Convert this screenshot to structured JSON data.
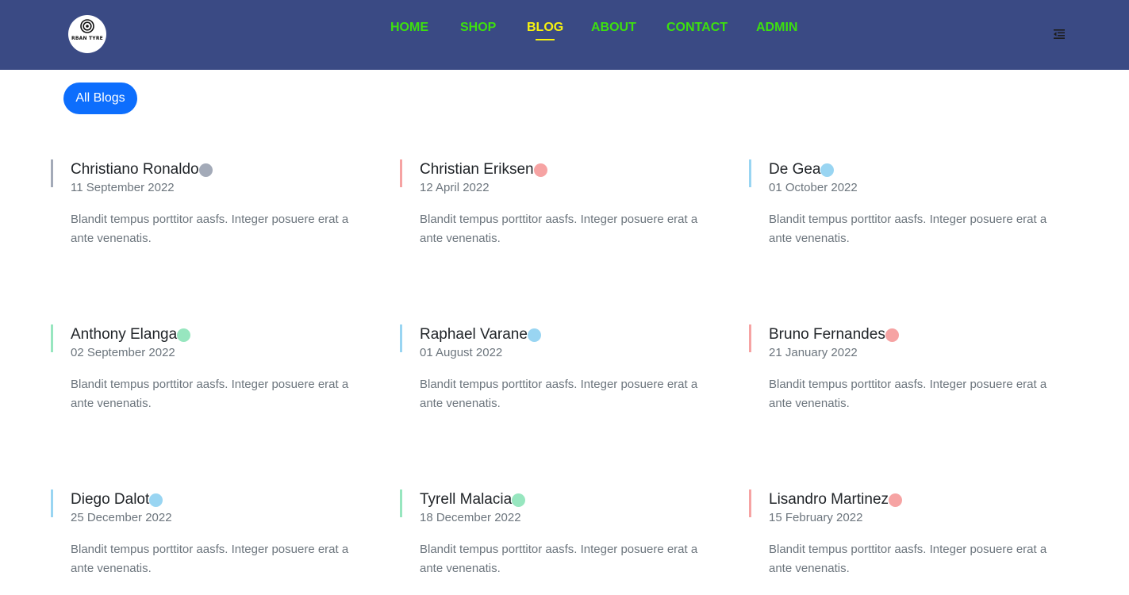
{
  "header": {
    "logo_text": "RBAN TYRE",
    "nav": [
      {
        "label": "HOME",
        "active": false
      },
      {
        "label": "SHOP",
        "active": false
      },
      {
        "label": "BLOG",
        "active": true
      },
      {
        "label": "ABOUT",
        "active": false
      },
      {
        "label": "CONTACT",
        "active": false
      },
      {
        "label": "ADMIN",
        "active": false
      }
    ],
    "menu_icon": "menu-fold-icon",
    "colors": {
      "background": "#3a4a84",
      "link": "#3de00e",
      "active_link": "#f7f20f"
    }
  },
  "filter": {
    "all_blogs_label": "All Blogs",
    "color": "#0d6efd"
  },
  "blogs": [
    {
      "title": "Christiano Ronaldo",
      "date": "11 September 2022",
      "excerpt": "Blandit tempus porttitor aasfs. Integer posuere erat a ante venenatis.",
      "color": "#a3aab8"
    },
    {
      "title": "Christian Eriksen",
      "date": "12 April 2022",
      "excerpt": "Blandit tempus porttitor aasfs. Integer posuere erat a ante venenatis.",
      "color": "#f6a3a3"
    },
    {
      "title": "De Gea",
      "date": "01 October 2022",
      "excerpt": "Blandit tempus porttitor aasfs. Integer posuere erat a ante venenatis.",
      "color": "#99d5f2"
    },
    {
      "title": "Anthony Elanga",
      "date": "02 September 2022",
      "excerpt": "Blandit tempus porttitor aasfs. Integer posuere erat a ante venenatis.",
      "color": "#97e6bf"
    },
    {
      "title": "Raphael Varane",
      "date": "01 August 2022",
      "excerpt": "Blandit tempus porttitor aasfs. Integer posuere erat a ante venenatis.",
      "color": "#99d5f2"
    },
    {
      "title": "Bruno Fernandes",
      "date": "21 January 2022",
      "excerpt": "Blandit tempus porttitor aasfs. Integer posuere erat a ante venenatis.",
      "color": "#f6a3a3"
    },
    {
      "title": "Diego Dalot",
      "date": "25 December 2022",
      "excerpt": "Blandit tempus porttitor aasfs. Integer posuere erat a ante venenatis.",
      "color": "#99d5f2"
    },
    {
      "title": "Tyrell Malacia",
      "date": "18 December 2022",
      "excerpt": "Blandit tempus porttitor aasfs. Integer posuere erat a ante venenatis.",
      "color": "#97e6bf"
    },
    {
      "title": "Lisandro Martinez",
      "date": "15 February 2022",
      "excerpt": "Blandit tempus porttitor aasfs. Integer posuere erat a ante venenatis.",
      "color": "#f6a3a3"
    }
  ]
}
